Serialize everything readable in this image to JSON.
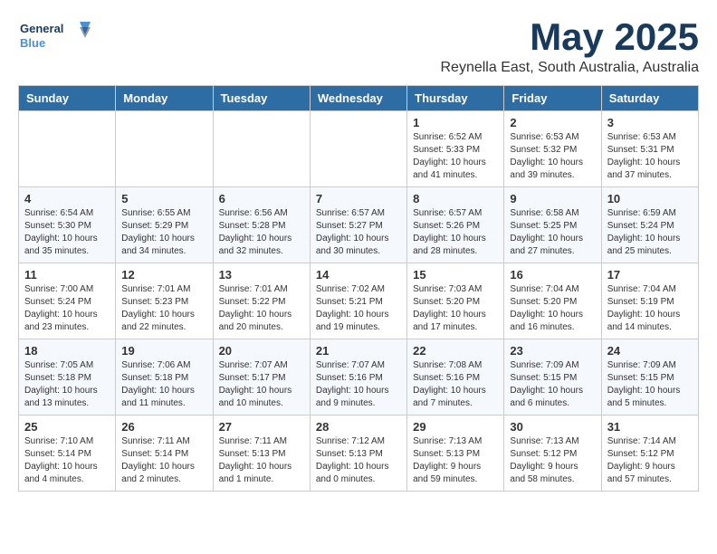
{
  "header": {
    "logo_general": "General",
    "logo_blue": "Blue",
    "title": "May 2025",
    "subtitle": "Reynella East, South Australia, Australia"
  },
  "days_of_week": [
    "Sunday",
    "Monday",
    "Tuesday",
    "Wednesday",
    "Thursday",
    "Friday",
    "Saturday"
  ],
  "weeks": [
    [
      {
        "day": "",
        "info": ""
      },
      {
        "day": "",
        "info": ""
      },
      {
        "day": "",
        "info": ""
      },
      {
        "day": "",
        "info": ""
      },
      {
        "day": "1",
        "info": "Sunrise: 6:52 AM\nSunset: 5:33 PM\nDaylight: 10 hours\nand 41 minutes."
      },
      {
        "day": "2",
        "info": "Sunrise: 6:53 AM\nSunset: 5:32 PM\nDaylight: 10 hours\nand 39 minutes."
      },
      {
        "day": "3",
        "info": "Sunrise: 6:53 AM\nSunset: 5:31 PM\nDaylight: 10 hours\nand 37 minutes."
      }
    ],
    [
      {
        "day": "4",
        "info": "Sunrise: 6:54 AM\nSunset: 5:30 PM\nDaylight: 10 hours\nand 35 minutes."
      },
      {
        "day": "5",
        "info": "Sunrise: 6:55 AM\nSunset: 5:29 PM\nDaylight: 10 hours\nand 34 minutes."
      },
      {
        "day": "6",
        "info": "Sunrise: 6:56 AM\nSunset: 5:28 PM\nDaylight: 10 hours\nand 32 minutes."
      },
      {
        "day": "7",
        "info": "Sunrise: 6:57 AM\nSunset: 5:27 PM\nDaylight: 10 hours\nand 30 minutes."
      },
      {
        "day": "8",
        "info": "Sunrise: 6:57 AM\nSunset: 5:26 PM\nDaylight: 10 hours\nand 28 minutes."
      },
      {
        "day": "9",
        "info": "Sunrise: 6:58 AM\nSunset: 5:25 PM\nDaylight: 10 hours\nand 27 minutes."
      },
      {
        "day": "10",
        "info": "Sunrise: 6:59 AM\nSunset: 5:24 PM\nDaylight: 10 hours\nand 25 minutes."
      }
    ],
    [
      {
        "day": "11",
        "info": "Sunrise: 7:00 AM\nSunset: 5:24 PM\nDaylight: 10 hours\nand 23 minutes."
      },
      {
        "day": "12",
        "info": "Sunrise: 7:01 AM\nSunset: 5:23 PM\nDaylight: 10 hours\nand 22 minutes."
      },
      {
        "day": "13",
        "info": "Sunrise: 7:01 AM\nSunset: 5:22 PM\nDaylight: 10 hours\nand 20 minutes."
      },
      {
        "day": "14",
        "info": "Sunrise: 7:02 AM\nSunset: 5:21 PM\nDaylight: 10 hours\nand 19 minutes."
      },
      {
        "day": "15",
        "info": "Sunrise: 7:03 AM\nSunset: 5:20 PM\nDaylight: 10 hours\nand 17 minutes."
      },
      {
        "day": "16",
        "info": "Sunrise: 7:04 AM\nSunset: 5:20 PM\nDaylight: 10 hours\nand 16 minutes."
      },
      {
        "day": "17",
        "info": "Sunrise: 7:04 AM\nSunset: 5:19 PM\nDaylight: 10 hours\nand 14 minutes."
      }
    ],
    [
      {
        "day": "18",
        "info": "Sunrise: 7:05 AM\nSunset: 5:18 PM\nDaylight: 10 hours\nand 13 minutes."
      },
      {
        "day": "19",
        "info": "Sunrise: 7:06 AM\nSunset: 5:18 PM\nDaylight: 10 hours\nand 11 minutes."
      },
      {
        "day": "20",
        "info": "Sunrise: 7:07 AM\nSunset: 5:17 PM\nDaylight: 10 hours\nand 10 minutes."
      },
      {
        "day": "21",
        "info": "Sunrise: 7:07 AM\nSunset: 5:16 PM\nDaylight: 10 hours\nand 9 minutes."
      },
      {
        "day": "22",
        "info": "Sunrise: 7:08 AM\nSunset: 5:16 PM\nDaylight: 10 hours\nand 7 minutes."
      },
      {
        "day": "23",
        "info": "Sunrise: 7:09 AM\nSunset: 5:15 PM\nDaylight: 10 hours\nand 6 minutes."
      },
      {
        "day": "24",
        "info": "Sunrise: 7:09 AM\nSunset: 5:15 PM\nDaylight: 10 hours\nand 5 minutes."
      }
    ],
    [
      {
        "day": "25",
        "info": "Sunrise: 7:10 AM\nSunset: 5:14 PM\nDaylight: 10 hours\nand 4 minutes."
      },
      {
        "day": "26",
        "info": "Sunrise: 7:11 AM\nSunset: 5:14 PM\nDaylight: 10 hours\nand 2 minutes."
      },
      {
        "day": "27",
        "info": "Sunrise: 7:11 AM\nSunset: 5:13 PM\nDaylight: 10 hours\nand 1 minute."
      },
      {
        "day": "28",
        "info": "Sunrise: 7:12 AM\nSunset: 5:13 PM\nDaylight: 10 hours\nand 0 minutes."
      },
      {
        "day": "29",
        "info": "Sunrise: 7:13 AM\nSunset: 5:13 PM\nDaylight: 9 hours\nand 59 minutes."
      },
      {
        "day": "30",
        "info": "Sunrise: 7:13 AM\nSunset: 5:12 PM\nDaylight: 9 hours\nand 58 minutes."
      },
      {
        "day": "31",
        "info": "Sunrise: 7:14 AM\nSunset: 5:12 PM\nDaylight: 9 hours\nand 57 minutes."
      }
    ]
  ]
}
